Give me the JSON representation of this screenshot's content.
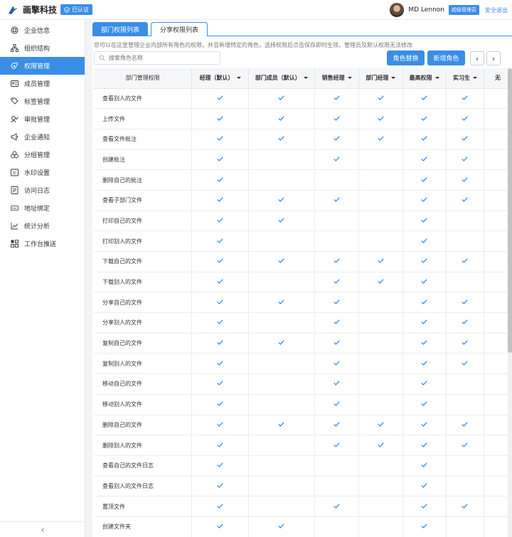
{
  "header": {
    "brand": "画擎科技",
    "verified": "已认证",
    "user_name": "MD Lennon",
    "role": "超级管理员",
    "logout": "安全退出"
  },
  "sidebar": {
    "items": [
      {
        "label": "企业信息",
        "icon": "building-icon"
      },
      {
        "label": "组织结构",
        "icon": "org-chart-icon"
      },
      {
        "label": "权限管理",
        "icon": "key-icon",
        "active": true
      },
      {
        "label": "成员管理",
        "icon": "id-card-icon"
      },
      {
        "label": "标签管理",
        "icon": "tag-icon"
      },
      {
        "label": "审批管理",
        "icon": "approval-icon"
      },
      {
        "label": "企业通知",
        "icon": "megaphone-icon"
      },
      {
        "label": "分组管理",
        "icon": "group-icon"
      },
      {
        "label": "水印设置",
        "icon": "watermark-icon"
      },
      {
        "label": "访问日志",
        "icon": "log-icon"
      },
      {
        "label": "地址绑定",
        "icon": "mac-icon"
      },
      {
        "label": "统计分析",
        "icon": "chart-icon"
      },
      {
        "label": "工作台推送",
        "icon": "dashboard-icon"
      }
    ],
    "collapse": "‹"
  },
  "tabs": [
    {
      "label": "部门权限列表",
      "active": true
    },
    {
      "label": "分享权限列表",
      "active": false
    }
  ],
  "description": "您可以在这里管理企业内部所有角色的权限，并且新增特定的角色，选择权限后点击保存即时生效，管理员及默认权限无法修改",
  "search": {
    "placeholder": "搜索角色名称"
  },
  "buttons": {
    "swap": "角色替换",
    "add": "新增角色",
    "prev": "‹",
    "next": "›"
  },
  "table": {
    "headers": [
      "部门管理权限",
      "经理（默认）",
      "部门成员（默认）",
      "销售经理",
      "部门经理",
      "最高权限",
      "实习生",
      "无"
    ],
    "rows": [
      {
        "name": "查看别人的文件",
        "checks": [
          1,
          1,
          1,
          1,
          1,
          1,
          0
        ]
      },
      {
        "name": "上传文件",
        "checks": [
          1,
          1,
          1,
          1,
          1,
          1,
          0
        ]
      },
      {
        "name": "查看文件批注",
        "checks": [
          1,
          1,
          1,
          1,
          1,
          1,
          0
        ]
      },
      {
        "name": "创建批注",
        "checks": [
          1,
          0,
          1,
          0,
          1,
          1,
          0
        ]
      },
      {
        "name": "删除自己的批注",
        "checks": [
          1,
          0,
          0,
          0,
          1,
          1,
          0
        ]
      },
      {
        "name": "查看子部门文件",
        "checks": [
          1,
          1,
          1,
          0,
          1,
          1,
          0
        ]
      },
      {
        "name": "打印自己的文件",
        "checks": [
          1,
          1,
          0,
          0,
          1,
          0,
          0
        ]
      },
      {
        "name": "打印别人的文件",
        "checks": [
          1,
          0,
          0,
          0,
          1,
          0,
          0
        ]
      },
      {
        "name": "下载自己的文件",
        "checks": [
          1,
          1,
          1,
          1,
          1,
          1,
          0
        ]
      },
      {
        "name": "下载别人的文件",
        "checks": [
          1,
          0,
          1,
          1,
          1,
          0,
          0
        ]
      },
      {
        "name": "分享自己的文件",
        "checks": [
          1,
          1,
          1,
          0,
          1,
          1,
          0
        ]
      },
      {
        "name": "分享别人的文件",
        "checks": [
          1,
          0,
          1,
          0,
          1,
          1,
          0
        ]
      },
      {
        "name": "复制自己的文件",
        "checks": [
          1,
          1,
          1,
          0,
          1,
          1,
          0
        ]
      },
      {
        "name": "复制别人的文件",
        "checks": [
          1,
          0,
          1,
          0,
          1,
          1,
          0
        ]
      },
      {
        "name": "移动自己的文件",
        "checks": [
          1,
          0,
          1,
          0,
          1,
          0,
          0
        ]
      },
      {
        "name": "移动别人的文件",
        "checks": [
          1,
          0,
          1,
          0,
          1,
          0,
          0
        ]
      },
      {
        "name": "删除自己的文件",
        "checks": [
          1,
          1,
          1,
          1,
          1,
          1,
          0
        ]
      },
      {
        "name": "删除别人的文件",
        "checks": [
          1,
          0,
          1,
          1,
          1,
          1,
          0
        ]
      },
      {
        "name": "查看自己的文件日志",
        "checks": [
          1,
          0,
          0,
          0,
          1,
          0,
          0
        ]
      },
      {
        "name": "查看别人的文件日志",
        "checks": [
          1,
          0,
          0,
          0,
          1,
          0,
          0
        ]
      },
      {
        "name": "置顶文件",
        "checks": [
          1,
          0,
          1,
          0,
          1,
          1,
          0
        ]
      },
      {
        "name": "创建文件夹",
        "checks": [
          1,
          1,
          0,
          0,
          1,
          0,
          0
        ]
      }
    ]
  },
  "colors": {
    "accent": "#3a8ee6",
    "check": "#3a8ee6"
  }
}
